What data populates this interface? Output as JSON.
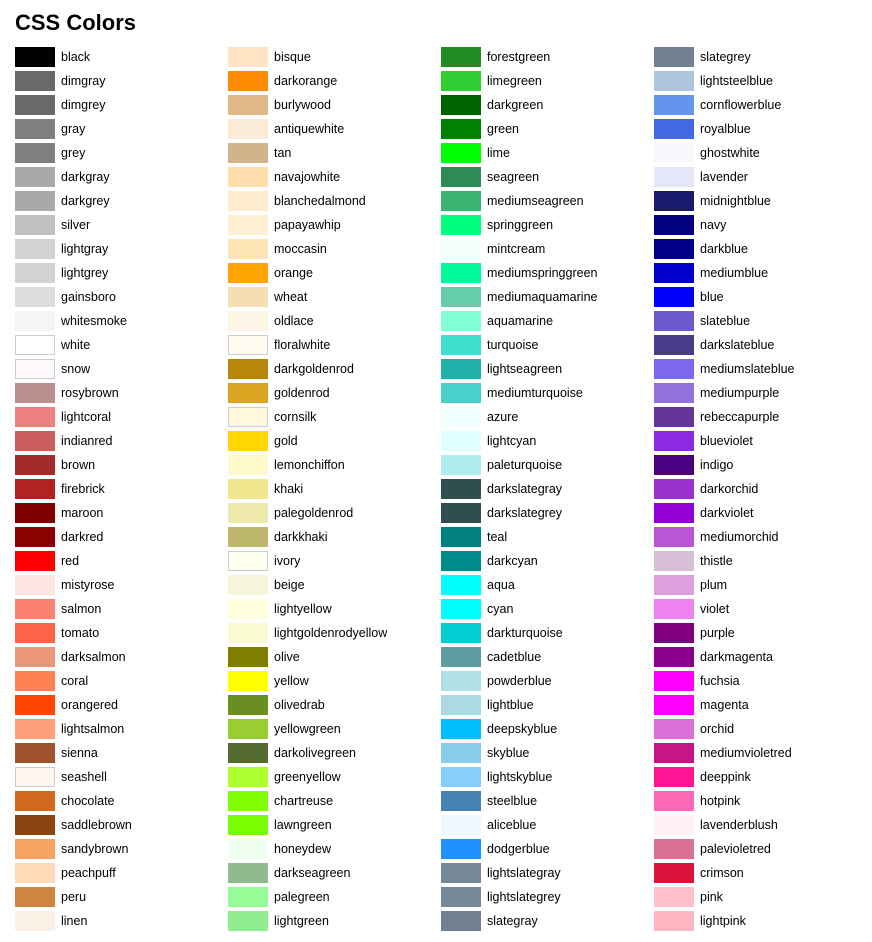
{
  "title": "CSS Colors",
  "colors": [
    {
      "name": "black",
      "hex": "#000000"
    },
    {
      "name": "bisque",
      "hex": "#FFE4C4"
    },
    {
      "name": "forestgreen",
      "hex": "#228B22"
    },
    {
      "name": "slategrey",
      "hex": "#708090"
    },
    {
      "name": "dimgray",
      "hex": "#696969"
    },
    {
      "name": "darkorange",
      "hex": "#FF8C00"
    },
    {
      "name": "limegreen",
      "hex": "#32CD32"
    },
    {
      "name": "lightsteelblue",
      "hex": "#B0C4DE"
    },
    {
      "name": "dimgrey",
      "hex": "#696969"
    },
    {
      "name": "burlywood",
      "hex": "#DEB887"
    },
    {
      "name": "darkgreen",
      "hex": "#006400"
    },
    {
      "name": "cornflowerblue",
      "hex": "#6495ED"
    },
    {
      "name": "gray",
      "hex": "#808080"
    },
    {
      "name": "antiquewhite",
      "hex": "#FAEBD7"
    },
    {
      "name": "green",
      "hex": "#008000"
    },
    {
      "name": "royalblue",
      "hex": "#4169E1"
    },
    {
      "name": "grey",
      "hex": "#808080"
    },
    {
      "name": "tan",
      "hex": "#D2B48C"
    },
    {
      "name": "lime",
      "hex": "#00FF00"
    },
    {
      "name": "ghostwhite",
      "hex": "#F8F8FF"
    },
    {
      "name": "darkgray",
      "hex": "#A9A9A9"
    },
    {
      "name": "navajowhite",
      "hex": "#FFDEAD"
    },
    {
      "name": "seagreen",
      "hex": "#2E8B57"
    },
    {
      "name": "lavender",
      "hex": "#E6E6FA"
    },
    {
      "name": "darkgrey",
      "hex": "#A9A9A9"
    },
    {
      "name": "blanchedalmond",
      "hex": "#FFEBCD"
    },
    {
      "name": "mediumseagreen",
      "hex": "#3CB371"
    },
    {
      "name": "midnightblue",
      "hex": "#191970"
    },
    {
      "name": "silver",
      "hex": "#C0C0C0"
    },
    {
      "name": "papayawhip",
      "hex": "#FFEFD5"
    },
    {
      "name": "springgreen",
      "hex": "#00FF7F"
    },
    {
      "name": "navy",
      "hex": "#000080"
    },
    {
      "name": "lightgray",
      "hex": "#D3D3D3"
    },
    {
      "name": "moccasin",
      "hex": "#FFE4B5"
    },
    {
      "name": "mintcream",
      "hex": "#F5FFFA"
    },
    {
      "name": "darkblue",
      "hex": "#00008B"
    },
    {
      "name": "lightgrey",
      "hex": "#D3D3D3"
    },
    {
      "name": "orange",
      "hex": "#FFA500"
    },
    {
      "name": "mediumspringgreen",
      "hex": "#00FA9A"
    },
    {
      "name": "mediumblue",
      "hex": "#0000CD"
    },
    {
      "name": "gainsboro",
      "hex": "#DCDCDC"
    },
    {
      "name": "wheat",
      "hex": "#F5DEB3"
    },
    {
      "name": "mediumaquamarine",
      "hex": "#66CDAA"
    },
    {
      "name": "blue",
      "hex": "#0000FF"
    },
    {
      "name": "whitesmoke",
      "hex": "#F5F5F5"
    },
    {
      "name": "oldlace",
      "hex": "#FDF5E6"
    },
    {
      "name": "aquamarine",
      "hex": "#7FFFD4"
    },
    {
      "name": "slateblue",
      "hex": "#6A5ACD"
    },
    {
      "name": "white",
      "hex": "#FFFFFF"
    },
    {
      "name": "floralwhite",
      "hex": "#FFFAF0"
    },
    {
      "name": "turquoise",
      "hex": "#40E0D0"
    },
    {
      "name": "darkslateblue",
      "hex": "#483D8B"
    },
    {
      "name": "snow",
      "hex": "#FFFAFA"
    },
    {
      "name": "darkgoldenrod",
      "hex": "#B8860B"
    },
    {
      "name": "lightseagreen",
      "hex": "#20B2AA"
    },
    {
      "name": "mediumslateblue",
      "hex": "#7B68EE"
    },
    {
      "name": "rosybrown",
      "hex": "#BC8F8F"
    },
    {
      "name": "goldenrod",
      "hex": "#DAA520"
    },
    {
      "name": "mediumturquoise",
      "hex": "#48D1CC"
    },
    {
      "name": "mediumpurple",
      "hex": "#9370DB"
    },
    {
      "name": "lightcoral",
      "hex": "#F08080"
    },
    {
      "name": "cornsilk",
      "hex": "#FFF8DC"
    },
    {
      "name": "azure",
      "hex": "#F0FFFF"
    },
    {
      "name": "rebeccapurple",
      "hex": "#663399"
    },
    {
      "name": "indianred",
      "hex": "#CD5C5C"
    },
    {
      "name": "gold",
      "hex": "#FFD700"
    },
    {
      "name": "lightcyan",
      "hex": "#E0FFFF"
    },
    {
      "name": "blueviolet",
      "hex": "#8A2BE2"
    },
    {
      "name": "brown",
      "hex": "#A52A2A"
    },
    {
      "name": "lemonchiffon",
      "hex": "#FFFACD"
    },
    {
      "name": "paleturquoise",
      "hex": "#AFEEEE"
    },
    {
      "name": "indigo",
      "hex": "#4B0082"
    },
    {
      "name": "firebrick",
      "hex": "#B22222"
    },
    {
      "name": "khaki",
      "hex": "#F0E68C"
    },
    {
      "name": "darkslategray",
      "hex": "#2F4F4F"
    },
    {
      "name": "darkorchid",
      "hex": "#9932CC"
    },
    {
      "name": "maroon",
      "hex": "#800000"
    },
    {
      "name": "palegoldenrod",
      "hex": "#EEE8AA"
    },
    {
      "name": "darkslategrey",
      "hex": "#2F4F4F"
    },
    {
      "name": "darkviolet",
      "hex": "#9400D3"
    },
    {
      "name": "darkred",
      "hex": "#8B0000"
    },
    {
      "name": "darkkhaki",
      "hex": "#BDB76B"
    },
    {
      "name": "teal",
      "hex": "#008080"
    },
    {
      "name": "mediumorchid",
      "hex": "#BA55D3"
    },
    {
      "name": "red",
      "hex": "#FF0000"
    },
    {
      "name": "ivory",
      "hex": "#FFFFF0"
    },
    {
      "name": "darkcyan",
      "hex": "#008B8B"
    },
    {
      "name": "thistle",
      "hex": "#D8BFD8"
    },
    {
      "name": "mistyrose",
      "hex": "#FFE4E1"
    },
    {
      "name": "beige",
      "hex": "#F5F5DC"
    },
    {
      "name": "aqua",
      "hex": "#00FFFF"
    },
    {
      "name": "plum",
      "hex": "#DDA0DD"
    },
    {
      "name": "salmon",
      "hex": "#FA8072"
    },
    {
      "name": "lightyellow",
      "hex": "#FFFFE0"
    },
    {
      "name": "cyan",
      "hex": "#00FFFF"
    },
    {
      "name": "violet",
      "hex": "#EE82EE"
    },
    {
      "name": "tomato",
      "hex": "#FF6347"
    },
    {
      "name": "lightgoldenrodyellow",
      "hex": "#FAFAD2"
    },
    {
      "name": "darkturquoise",
      "hex": "#00CED1"
    },
    {
      "name": "purple",
      "hex": "#800080"
    },
    {
      "name": "darksalmon",
      "hex": "#E9967A"
    },
    {
      "name": "olive",
      "hex": "#808000"
    },
    {
      "name": "cadetblue",
      "hex": "#5F9EA0"
    },
    {
      "name": "darkmagenta",
      "hex": "#8B008B"
    },
    {
      "name": "coral",
      "hex": "#FF7F50"
    },
    {
      "name": "yellow",
      "hex": "#FFFF00"
    },
    {
      "name": "powderblue",
      "hex": "#B0E0E6"
    },
    {
      "name": "fuchsia",
      "hex": "#FF00FF"
    },
    {
      "name": "orangered",
      "hex": "#FF4500"
    },
    {
      "name": "olivedrab",
      "hex": "#6B8E23"
    },
    {
      "name": "lightblue",
      "hex": "#ADD8E6"
    },
    {
      "name": "magenta",
      "hex": "#FF00FF"
    },
    {
      "name": "lightsalmon",
      "hex": "#FFA07A"
    },
    {
      "name": "yellowgreen",
      "hex": "#9ACD32"
    },
    {
      "name": "deepskyblue",
      "hex": "#00BFFF"
    },
    {
      "name": "orchid",
      "hex": "#DA70D6"
    },
    {
      "name": "sienna",
      "hex": "#A0522D"
    },
    {
      "name": "darkolivegreen",
      "hex": "#556B2F"
    },
    {
      "name": "skyblue",
      "hex": "#87CEEB"
    },
    {
      "name": "mediumvioletred",
      "hex": "#C71585"
    },
    {
      "name": "seashell",
      "hex": "#FFF5EE"
    },
    {
      "name": "greenyellow",
      "hex": "#ADFF2F"
    },
    {
      "name": "lightskyblue",
      "hex": "#87CEFA"
    },
    {
      "name": "deeppink",
      "hex": "#FF1493"
    },
    {
      "name": "chocolate",
      "hex": "#D2691E"
    },
    {
      "name": "chartreuse",
      "hex": "#7FFF00"
    },
    {
      "name": "steelblue",
      "hex": "#4682B4"
    },
    {
      "name": "hotpink",
      "hex": "#FF69B4"
    },
    {
      "name": "saddlebrown",
      "hex": "#8B4513"
    },
    {
      "name": "lawngreen",
      "hex": "#7CFC00"
    },
    {
      "name": "aliceblue",
      "hex": "#F0F8FF"
    },
    {
      "name": "lavenderblush",
      "hex": "#FFF0F5"
    },
    {
      "name": "sandybrown",
      "hex": "#F4A460"
    },
    {
      "name": "honeydew",
      "hex": "#F0FFF0"
    },
    {
      "name": "dodgerblue",
      "hex": "#1E90FF"
    },
    {
      "name": "palevioletred",
      "hex": "#DB7093"
    },
    {
      "name": "peachpuff",
      "hex": "#FFDAB9"
    },
    {
      "name": "darkseagreen",
      "hex": "#8FBC8F"
    },
    {
      "name": "lightslategray",
      "hex": "#778899"
    },
    {
      "name": "crimson",
      "hex": "#DC143C"
    },
    {
      "name": "peru",
      "hex": "#CD853F"
    },
    {
      "name": "palegreen",
      "hex": "#98FB98"
    },
    {
      "name": "lightslategrey",
      "hex": "#778899"
    },
    {
      "name": "pink",
      "hex": "#FFC0CB"
    },
    {
      "name": "linen",
      "hex": "#FAF0E6"
    },
    {
      "name": "lightgreen",
      "hex": "#90EE90"
    },
    {
      "name": "slategray",
      "hex": "#708090"
    },
    {
      "name": "lightpink",
      "hex": "#FFB6C1"
    }
  ]
}
